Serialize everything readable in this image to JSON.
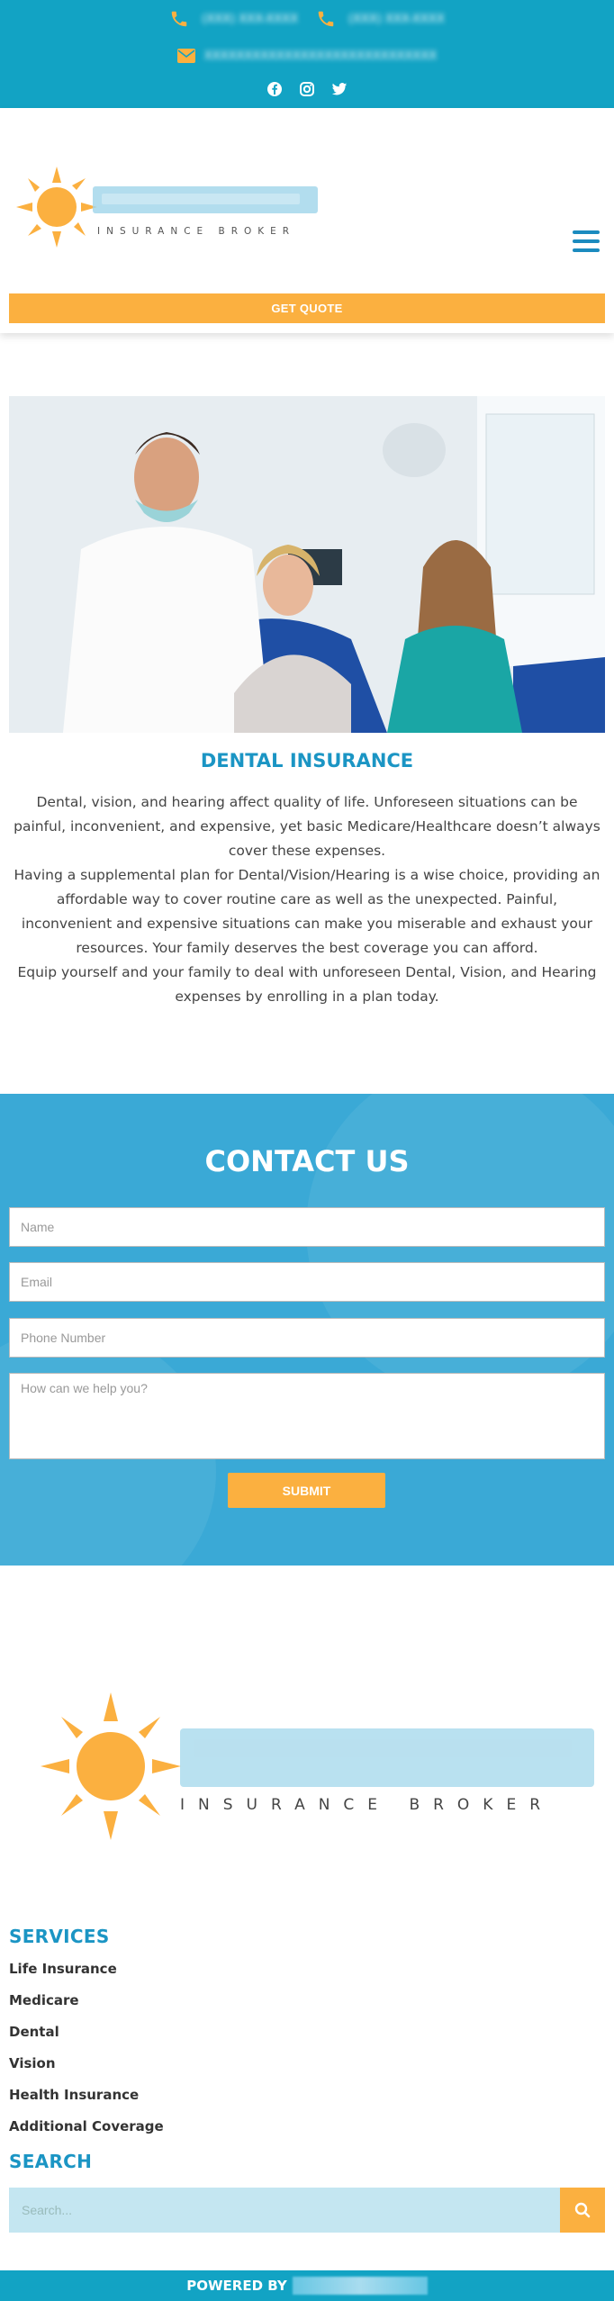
{
  "topbar": {
    "phone1": "(XXX) XXX-XXXX",
    "phone2": "(XXX) XXX-XXXX",
    "email": "XXXXXXXXXXXXXXXXXXXXXXXXXXXXX",
    "social": [
      "facebook-icon",
      "instagram-icon",
      "twitter-icon"
    ],
    "bg_color": "#12a3c4",
    "icon_color": "#fbb040"
  },
  "header": {
    "logo_tagline": "INSURANCE BROKER",
    "quote_button": "GET QUOTE"
  },
  "dental": {
    "title": "DENTAL INSURANCE",
    "paragraph1": "Dental, vision, and hearing affect quality of life. Unforeseen situations can be painful, inconvenient, and expensive, yet basic Medicare/Healthcare doesn’t always cover these expenses.",
    "paragraph2": "Having a supplemental plan for Dental/Vision/Hearing is a wise choice, providing an affordable way to cover routine care as well as the unexpected. Painful, inconvenient and expensive situations can make you miserable and exhaust your resources. Your family deserves the best coverage you can afford.",
    "paragraph3": "Equip yourself and your family to deal with unforeseen Dental, Vision, and Hearing expenses by enrolling in a plan today."
  },
  "contact": {
    "title": "CONTACT US",
    "name_placeholder": "Name",
    "email_placeholder": "Email",
    "phone_placeholder": "Phone Number",
    "message_placeholder": "How can we help you?",
    "submit_label": "SUBMIT"
  },
  "footer": {
    "logo_tagline": "INSURANCE BROKER",
    "services_title": "SERVICES",
    "services": [
      "Life Insurance",
      "Medicare",
      "Dental",
      "Vision",
      "Health Insurance",
      "Additional Coverage"
    ],
    "search_title": "SEARCH",
    "search_placeholder": "Search...",
    "powered_by": "POWERED BY"
  },
  "colors": {
    "accent": "#fbb040",
    "brand_blue": "#1b95c4"
  }
}
